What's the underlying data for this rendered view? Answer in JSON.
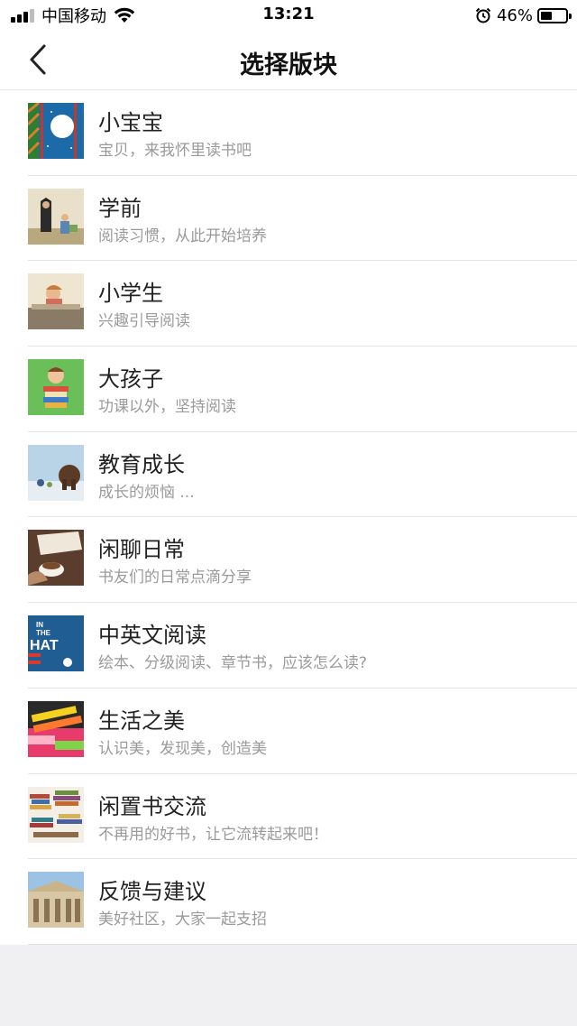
{
  "status_bar": {
    "carrier": "中国移动",
    "time": "13:21",
    "battery_percent": "46%",
    "battery_level": 0.46,
    "signal_bars": 3,
    "icons": [
      "signal-icon",
      "wifi-icon",
      "alarm-icon",
      "battery-icon"
    ]
  },
  "nav": {
    "title": "选择版块",
    "back_icon": "chevron-left-icon"
  },
  "sections": [
    {
      "title": "小宝宝",
      "subtitle": "宝贝，来我怀里读书吧"
    },
    {
      "title": "学前",
      "subtitle": "阅读习惯，从此开始培养"
    },
    {
      "title": "小学生",
      "subtitle": "兴趣引导阅读"
    },
    {
      "title": "大孩子",
      "subtitle": "功课以外，坚持阅读"
    },
    {
      "title": "教育成长",
      "subtitle": "成长的烦恼 ..."
    },
    {
      "title": "闲聊日常",
      "subtitle": "书友们的日常点滴分享"
    },
    {
      "title": "中英文阅读",
      "subtitle": "绘本、分级阅读、章节书，应该怎么读?"
    },
    {
      "title": "生活之美",
      "subtitle": "认识美，发现美，创造美"
    },
    {
      "title": "闲置书交流",
      "subtitle": "不再用的好书，让它流转起来吧！"
    },
    {
      "title": "反馈与建议",
      "subtitle": "美好社区，大家一起支招"
    }
  ],
  "thumb_text": {
    "in": "IN",
    "the": "THE",
    "hat": "HAT"
  },
  "colors": {
    "background": "#f0f0f2",
    "title_text": "#222222",
    "subtitle_text": "#9a9a9a",
    "divider": "#e3e3e3"
  }
}
